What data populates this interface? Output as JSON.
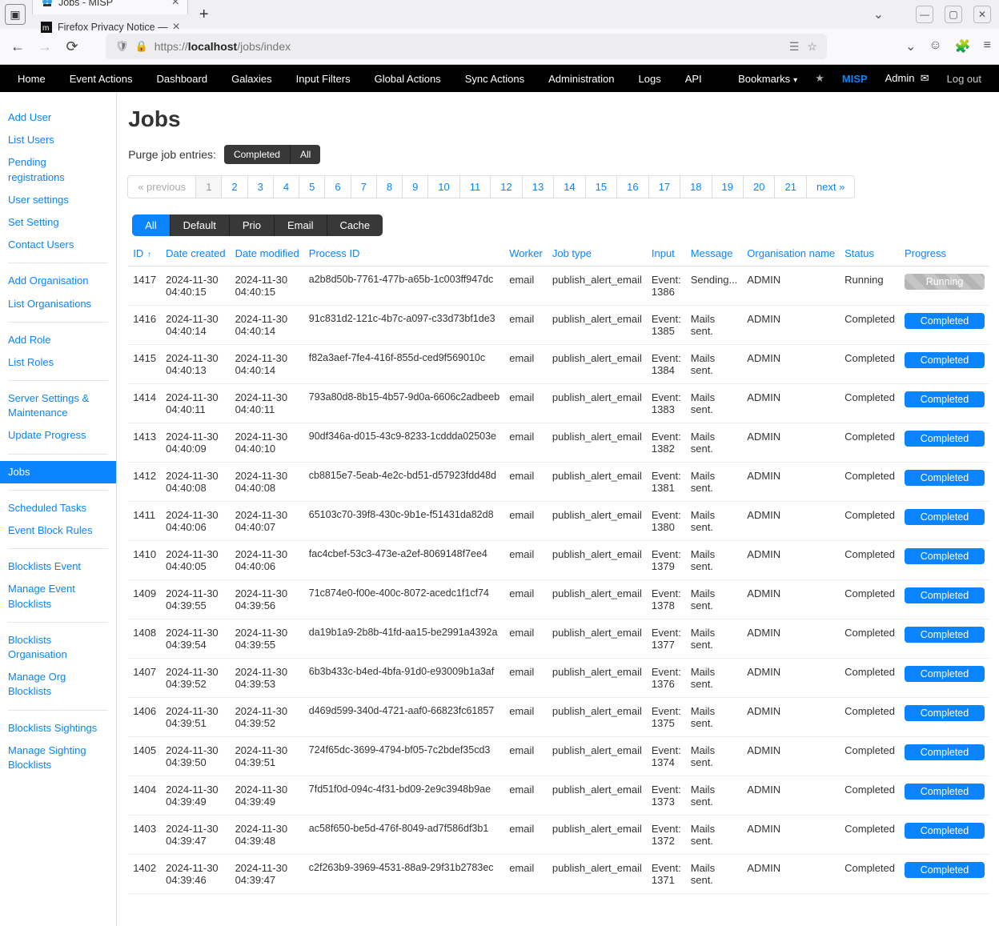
{
  "browser": {
    "tabs": [
      {
        "title": "Jobs - MISP",
        "active": true
      },
      {
        "title": "Firefox Privacy Notice —",
        "active": false
      }
    ],
    "url_prefix": "https://",
    "url_host": "localhost",
    "url_path": "/jobs/index"
  },
  "topnav": {
    "items": [
      "Home",
      "Event Actions",
      "Dashboard",
      "Galaxies",
      "Input Filters",
      "Global Actions",
      "Sync Actions",
      "Administration",
      "Logs",
      "API"
    ],
    "bookmarks": "Bookmarks",
    "misp": "MISP",
    "admin": "Admin",
    "logout": "Log out"
  },
  "sidebar": {
    "groups": [
      [
        "Add User",
        "List Users",
        "Pending registrations",
        "User settings",
        "Set Setting",
        "Contact Users"
      ],
      [
        "Add Organisation",
        "List Organisations"
      ],
      [
        "Add Role",
        "List Roles"
      ],
      [
        "Server Settings & Maintenance",
        "Update Progress"
      ],
      [
        "Jobs"
      ],
      [
        "Scheduled Tasks",
        "Event Block Rules"
      ],
      [
        "Blocklists Event",
        "Manage Event Blocklists"
      ],
      [
        "Blocklists Organisation",
        "Manage Org Blocklists"
      ],
      [
        "Blocklists Sightings",
        "Manage Sighting Blocklists"
      ]
    ],
    "active": "Jobs"
  },
  "page": {
    "title": "Jobs",
    "purge_label": "Purge job entries:",
    "purge_completed": "Completed",
    "purge_all": "All"
  },
  "pagination": {
    "prev": "« previous",
    "pages": [
      "1",
      "2",
      "3",
      "4",
      "5",
      "6",
      "7",
      "8",
      "9",
      "10",
      "11",
      "12",
      "13",
      "14",
      "15",
      "16",
      "17",
      "18",
      "19",
      "20",
      "21"
    ],
    "next": "next »",
    "active": "1"
  },
  "filters": {
    "items": [
      "All",
      "Default",
      "Prio",
      "Email",
      "Cache"
    ],
    "active": "All"
  },
  "columns": [
    "ID",
    "Date created",
    "Date modified",
    "Process ID",
    "Worker",
    "Job type",
    "Input",
    "Message",
    "Organisation name",
    "Status",
    "Progress"
  ],
  "chart_data": {
    "type": "table",
    "columns": [
      "ID",
      "Date created",
      "Date modified",
      "Process ID",
      "Worker",
      "Job type",
      "Input",
      "Message",
      "Organisation name",
      "Status",
      "Progress"
    ],
    "rows": [
      {
        "id": "1417",
        "created": "2024-11-30 04:40:15",
        "modified": "2024-11-30 04:40:15",
        "pid": "a2b8d50b-7761-477b-a65b-1c003ff947dc",
        "worker": "email",
        "jobtype": "publish_alert_email",
        "input": "Event: 1386",
        "message": "Sending...",
        "org": "ADMIN",
        "status": "Running",
        "progress": "Running"
      },
      {
        "id": "1416",
        "created": "2024-11-30 04:40:14",
        "modified": "2024-11-30 04:40:14",
        "pid": "91c831d2-121c-4b7c-a097-c33d73bf1de3",
        "worker": "email",
        "jobtype": "publish_alert_email",
        "input": "Event: 1385",
        "message": "Mails sent.",
        "org": "ADMIN",
        "status": "Completed",
        "progress": "Completed"
      },
      {
        "id": "1415",
        "created": "2024-11-30 04:40:13",
        "modified": "2024-11-30 04:40:14",
        "pid": "f82a3aef-7fe4-416f-855d-ced9f569010c",
        "worker": "email",
        "jobtype": "publish_alert_email",
        "input": "Event: 1384",
        "message": "Mails sent.",
        "org": "ADMIN",
        "status": "Completed",
        "progress": "Completed"
      },
      {
        "id": "1414",
        "created": "2024-11-30 04:40:11",
        "modified": "2024-11-30 04:40:11",
        "pid": "793a80d8-8b15-4b57-9d0a-6606c2adbeeb",
        "worker": "email",
        "jobtype": "publish_alert_email",
        "input": "Event: 1383",
        "message": "Mails sent.",
        "org": "ADMIN",
        "status": "Completed",
        "progress": "Completed"
      },
      {
        "id": "1413",
        "created": "2024-11-30 04:40:09",
        "modified": "2024-11-30 04:40:10",
        "pid": "90df346a-d015-43c9-8233-1cddda02503e",
        "worker": "email",
        "jobtype": "publish_alert_email",
        "input": "Event: 1382",
        "message": "Mails sent.",
        "org": "ADMIN",
        "status": "Completed",
        "progress": "Completed"
      },
      {
        "id": "1412",
        "created": "2024-11-30 04:40:08",
        "modified": "2024-11-30 04:40:08",
        "pid": "cb8815e7-5eab-4e2c-bd51-d57923fdd48d",
        "worker": "email",
        "jobtype": "publish_alert_email",
        "input": "Event: 1381",
        "message": "Mails sent.",
        "org": "ADMIN",
        "status": "Completed",
        "progress": "Completed"
      },
      {
        "id": "1411",
        "created": "2024-11-30 04:40:06",
        "modified": "2024-11-30 04:40:07",
        "pid": "65103c70-39f8-430c-9b1e-f51431da82d8",
        "worker": "email",
        "jobtype": "publish_alert_email",
        "input": "Event: 1380",
        "message": "Mails sent.",
        "org": "ADMIN",
        "status": "Completed",
        "progress": "Completed"
      },
      {
        "id": "1410",
        "created": "2024-11-30 04:40:05",
        "modified": "2024-11-30 04:40:06",
        "pid": "fac4cbef-53c3-473e-a2ef-8069148f7ee4",
        "worker": "email",
        "jobtype": "publish_alert_email",
        "input": "Event: 1379",
        "message": "Mails sent.",
        "org": "ADMIN",
        "status": "Completed",
        "progress": "Completed"
      },
      {
        "id": "1409",
        "created": "2024-11-30 04:39:55",
        "modified": "2024-11-30 04:39:56",
        "pid": "71c874e0-f00e-400c-8072-acedc1f1cf74",
        "worker": "email",
        "jobtype": "publish_alert_email",
        "input": "Event: 1378",
        "message": "Mails sent.",
        "org": "ADMIN",
        "status": "Completed",
        "progress": "Completed"
      },
      {
        "id": "1408",
        "created": "2024-11-30 04:39:54",
        "modified": "2024-11-30 04:39:55",
        "pid": "da19b1a9-2b8b-41fd-aa15-be2991a4392a",
        "worker": "email",
        "jobtype": "publish_alert_email",
        "input": "Event: 1377",
        "message": "Mails sent.",
        "org": "ADMIN",
        "status": "Completed",
        "progress": "Completed"
      },
      {
        "id": "1407",
        "created": "2024-11-30 04:39:52",
        "modified": "2024-11-30 04:39:53",
        "pid": "6b3b433c-b4ed-4bfa-91d0-e93009b1a3af",
        "worker": "email",
        "jobtype": "publish_alert_email",
        "input": "Event: 1376",
        "message": "Mails sent.",
        "org": "ADMIN",
        "status": "Completed",
        "progress": "Completed"
      },
      {
        "id": "1406",
        "created": "2024-11-30 04:39:51",
        "modified": "2024-11-30 04:39:52",
        "pid": "d469d599-340d-4721-aaf0-66823fc61857",
        "worker": "email",
        "jobtype": "publish_alert_email",
        "input": "Event: 1375",
        "message": "Mails sent.",
        "org": "ADMIN",
        "status": "Completed",
        "progress": "Completed"
      },
      {
        "id": "1405",
        "created": "2024-11-30 04:39:50",
        "modified": "2024-11-30 04:39:51",
        "pid": "724f65dc-3699-4794-bf05-7c2bdef35cd3",
        "worker": "email",
        "jobtype": "publish_alert_email",
        "input": "Event: 1374",
        "message": "Mails sent.",
        "org": "ADMIN",
        "status": "Completed",
        "progress": "Completed"
      },
      {
        "id": "1404",
        "created": "2024-11-30 04:39:49",
        "modified": "2024-11-30 04:39:49",
        "pid": "7fd51f0d-094c-4f31-bd09-2e9c3948b9ae",
        "worker": "email",
        "jobtype": "publish_alert_email",
        "input": "Event: 1373",
        "message": "Mails sent.",
        "org": "ADMIN",
        "status": "Completed",
        "progress": "Completed"
      },
      {
        "id": "1403",
        "created": "2024-11-30 04:39:47",
        "modified": "2024-11-30 04:39:48",
        "pid": "ac58f650-be5d-476f-8049-ad7f586df3b1",
        "worker": "email",
        "jobtype": "publish_alert_email",
        "input": "Event: 1372",
        "message": "Mails sent.",
        "org": "ADMIN",
        "status": "Completed",
        "progress": "Completed"
      },
      {
        "id": "1402",
        "created": "2024-11-30 04:39:46",
        "modified": "2024-11-30 04:39:47",
        "pid": "c2f263b9-3969-4531-88a9-29f31b2783ec",
        "worker": "email",
        "jobtype": "publish_alert_email",
        "input": "Event: 1371",
        "message": "Mails sent.",
        "org": "ADMIN",
        "status": "Completed",
        "progress": "Completed"
      }
    ]
  }
}
